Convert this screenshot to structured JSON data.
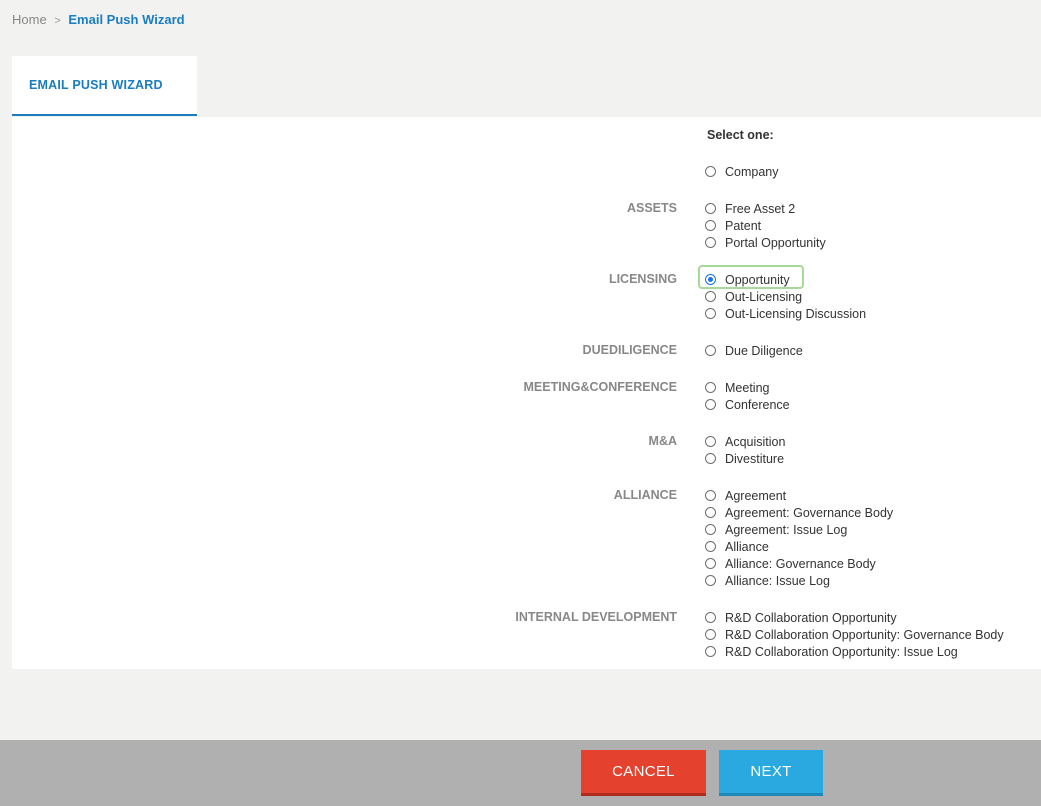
{
  "breadcrumb": {
    "home": "Home",
    "separator": ">",
    "current": "Email Push Wizard"
  },
  "tab": {
    "label": "EMAIL PUSH WIZARD"
  },
  "form": {
    "select_title": "Select one:",
    "selected": "Opportunity",
    "groups": [
      {
        "label": "",
        "options": [
          "Company"
        ]
      },
      {
        "label": "ASSETS",
        "options": [
          "Free Asset 2",
          "Patent",
          "Portal Opportunity"
        ]
      },
      {
        "label": "LICENSING",
        "options": [
          "Opportunity",
          "Out-Licensing",
          "Out-Licensing Discussion"
        ]
      },
      {
        "label": "DUEDILIGENCE",
        "options": [
          "Due Diligence"
        ]
      },
      {
        "label": "MEETING&CONFERENCE",
        "options": [
          "Meeting",
          "Conference"
        ]
      },
      {
        "label": "M&A",
        "options": [
          "Acquisition",
          "Divestiture"
        ]
      },
      {
        "label": "ALLIANCE",
        "options": [
          "Agreement",
          "Agreement: Governance Body",
          "Agreement: Issue Log",
          "Alliance",
          "Alliance: Governance Body",
          "Alliance: Issue Log"
        ]
      },
      {
        "label": "INTERNAL DEVELOPMENT",
        "options": [
          "R&D Collaboration Opportunity",
          "R&D Collaboration Opportunity: Governance Body",
          "R&D Collaboration Opportunity: Issue Log"
        ]
      }
    ]
  },
  "footer": {
    "cancel_label": "CANCEL",
    "next_label": "NEXT"
  },
  "colors": {
    "accent": "#1a7dbf",
    "cancel": "#e4412f",
    "next": "#29a9e0",
    "highlight": "#a8d99a"
  }
}
